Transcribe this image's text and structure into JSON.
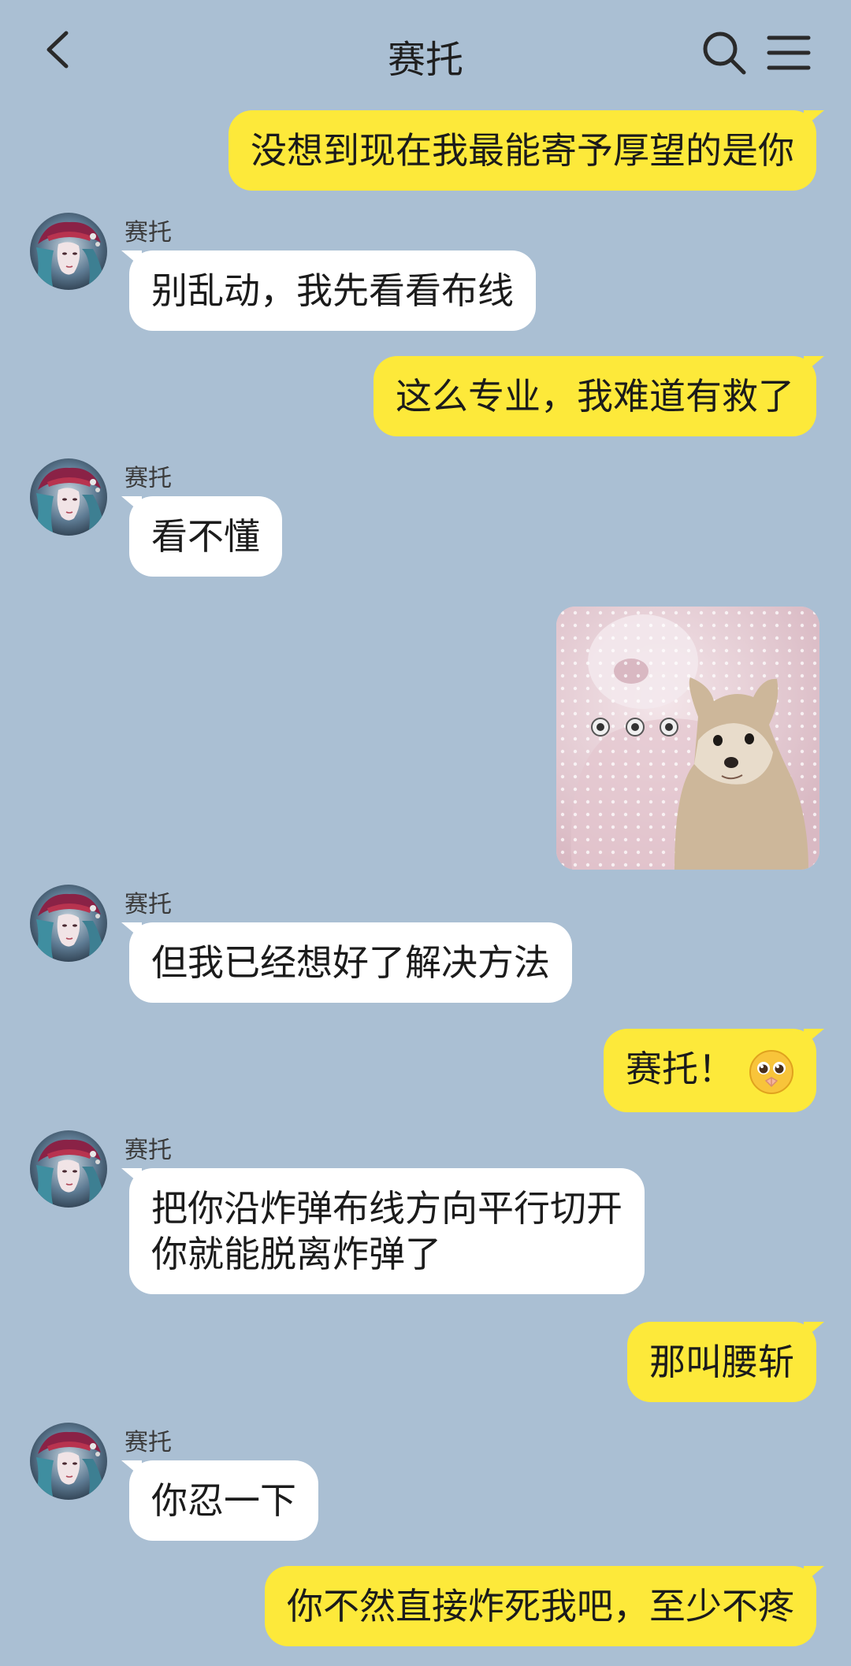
{
  "header": {
    "title": "赛托"
  },
  "contact": {
    "name": "赛托"
  },
  "messages": [
    {
      "dir": "out",
      "text": "没想到现在我最能寄予厚望的是你"
    },
    {
      "dir": "in",
      "sender": "赛托",
      "text": "别乱动，我先看看布线"
    },
    {
      "dir": "out",
      "text": "这么专业，我难道有救了"
    },
    {
      "dir": "in",
      "sender": "赛托",
      "text": "看不懂"
    },
    {
      "dir": "out",
      "type": "sticker",
      "sticker": "dog-meme-sticker"
    },
    {
      "dir": "in",
      "sender": "赛托",
      "text": "但我已经想好了解决方法"
    },
    {
      "dir": "out",
      "text": "赛托！",
      "emoji": "pleading-face-emoji"
    },
    {
      "dir": "in",
      "sender": "赛托",
      "text": "把你沿炸弹布线方向平行切开\n你就能脱离炸弹了"
    },
    {
      "dir": "out",
      "text": "那叫腰斩"
    },
    {
      "dir": "in",
      "sender": "赛托",
      "text": "你忍一下"
    },
    {
      "dir": "out",
      "text": "你不然直接炸死我吧，至少不疼"
    }
  ],
  "colors": {
    "background": "#aabfd3",
    "outgoing_bubble": "#fde93a",
    "incoming_bubble": "#ffffff"
  }
}
